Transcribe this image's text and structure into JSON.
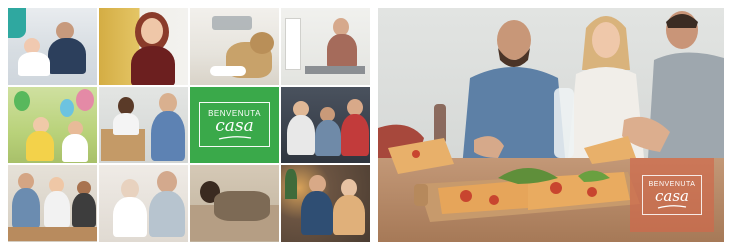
{
  "brand": {
    "top": "BENVENUTA",
    "main": "casa"
  },
  "collage": {
    "tiles": [
      {
        "name": "tile-mother-baby-sofa",
        "bg": "#dfe3e6",
        "accent": "#2c3f5c"
      },
      {
        "name": "tile-smiling-woman-yellow",
        "bg": "#d6b24c",
        "accent": "#8a3b2a"
      },
      {
        "name": "tile-dog-living-room",
        "bg": "#e9e6df",
        "accent": "#c8a26a"
      },
      {
        "name": "tile-woman-home-office",
        "bg": "#e8e8e4",
        "accent": "#a56b5b"
      },
      {
        "name": "tile-children-balloons",
        "bg": "#b9d27a",
        "accent": "#e48aa6"
      },
      {
        "name": "tile-couple-moving-boxes",
        "bg": "#d9dbd8",
        "accent": "#5d82b3"
      },
      {
        "name": "tile-brand-logo",
        "bg": "#3aa94a",
        "accent": "#ffffff"
      },
      {
        "name": "tile-friends-gaming",
        "bg": "#3f4652",
        "accent": "#c23b3b"
      },
      {
        "name": "tile-family-kitchen",
        "bg": "#d8d2c8",
        "accent": "#6b8cb0"
      },
      {
        "name": "tile-grandparent-child",
        "bg": "#e6e1db",
        "accent": "#d3a98d"
      },
      {
        "name": "tile-woman-relaxing-sofa",
        "bg": "#c9bca8",
        "accent": "#7d6a55"
      },
      {
        "name": "tile-couple-christmas",
        "bg": "#5a4a3c",
        "accent": "#e0b07a"
      }
    ]
  },
  "hero": {
    "scene": "friends sharing pizza",
    "colors": {
      "wall": "#d9dbd9",
      "table": "#b98a66",
      "board": "#c79a6c",
      "pizza": "#e6a55a",
      "sauce": "#c8452f",
      "basil": "#5f8f3a"
    }
  }
}
